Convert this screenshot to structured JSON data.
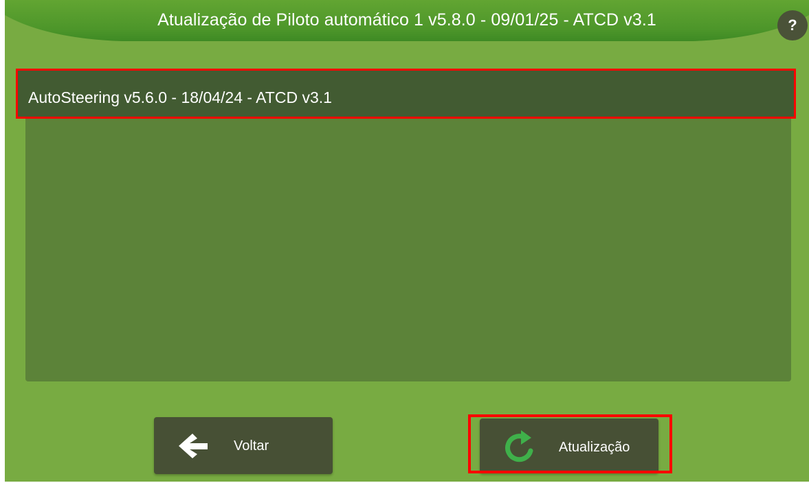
{
  "header": {
    "title": "Atualização de Piloto automático 1 v5.8.0 - 09/01/25 - ATCD v3.1",
    "help_label": "?"
  },
  "list": {
    "items": [
      {
        "label": "AutoSteering v5.6.0 - 18/04/24 - ATCD v3.1",
        "selected": true
      }
    ]
  },
  "footer": {
    "back_label": "Voltar",
    "back_icon": "arrow-left-icon",
    "update_label": "Atualização",
    "update_icon": "refresh-icon"
  },
  "colors": {
    "background": "#78ab42",
    "panel": "#5c8339",
    "selected_row": "#425b32",
    "button": "#475035",
    "highlight": "#ff0000",
    "refresh_icon": "#3fb04a"
  }
}
